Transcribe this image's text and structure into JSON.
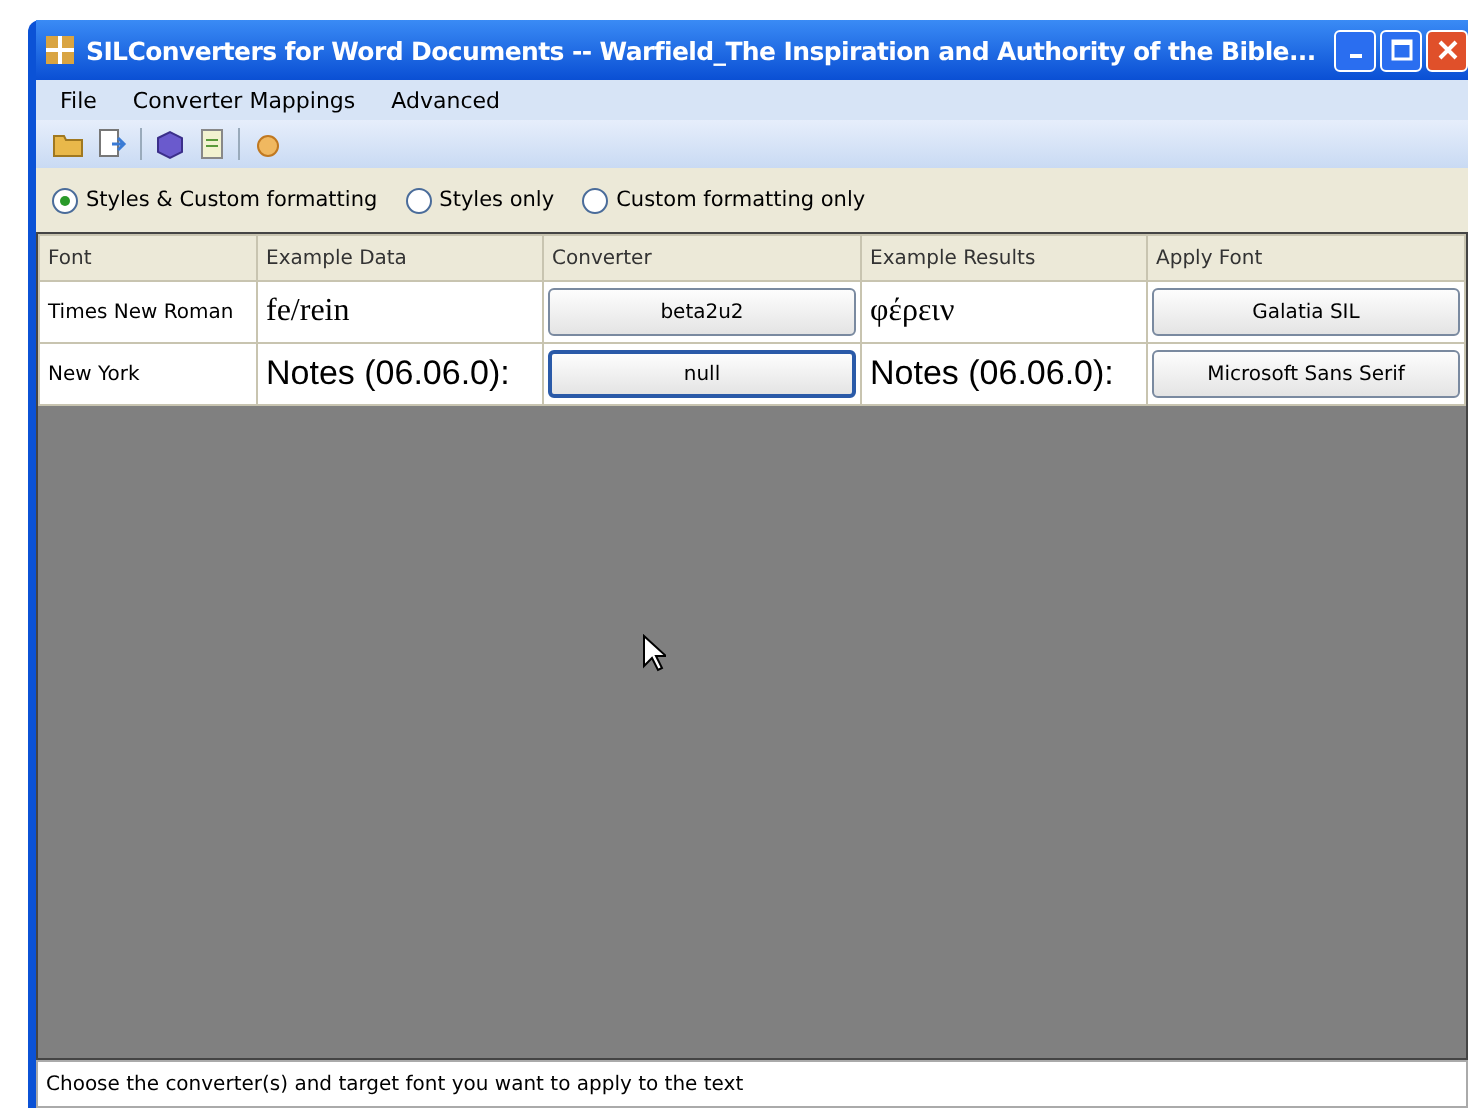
{
  "window": {
    "title": "SILConverters for Word Documents -- Warfield_The Inspiration and Authority of the Bible..."
  },
  "menu": [
    "File",
    "Converter Mappings",
    "Advanced"
  ],
  "radios": [
    {
      "label": "Styles & Custom formatting",
      "selected": true
    },
    {
      "label": "Styles only",
      "selected": false
    },
    {
      "label": "Custom formatting only",
      "selected": false
    }
  ],
  "table": {
    "columns": [
      "Font",
      "Example Data",
      "Converter",
      "Example Results",
      "Apply Font"
    ],
    "rows": [
      {
        "font": "Times New Roman",
        "example_data": "fe/rein",
        "converter": "beta2u2",
        "example_results": "φέρειν",
        "apply_font": "Galatia SIL",
        "kind": "serif",
        "selected": false
      },
      {
        "font": "New York",
        "example_data": "Notes (06.06.0):",
        "converter": "null",
        "example_results": "Notes (06.06.0):",
        "apply_font": "Microsoft Sans Serif",
        "kind": "sans",
        "selected": true
      }
    ]
  },
  "status_bar": "Choose the converter(s) and target font you want to apply to the text"
}
